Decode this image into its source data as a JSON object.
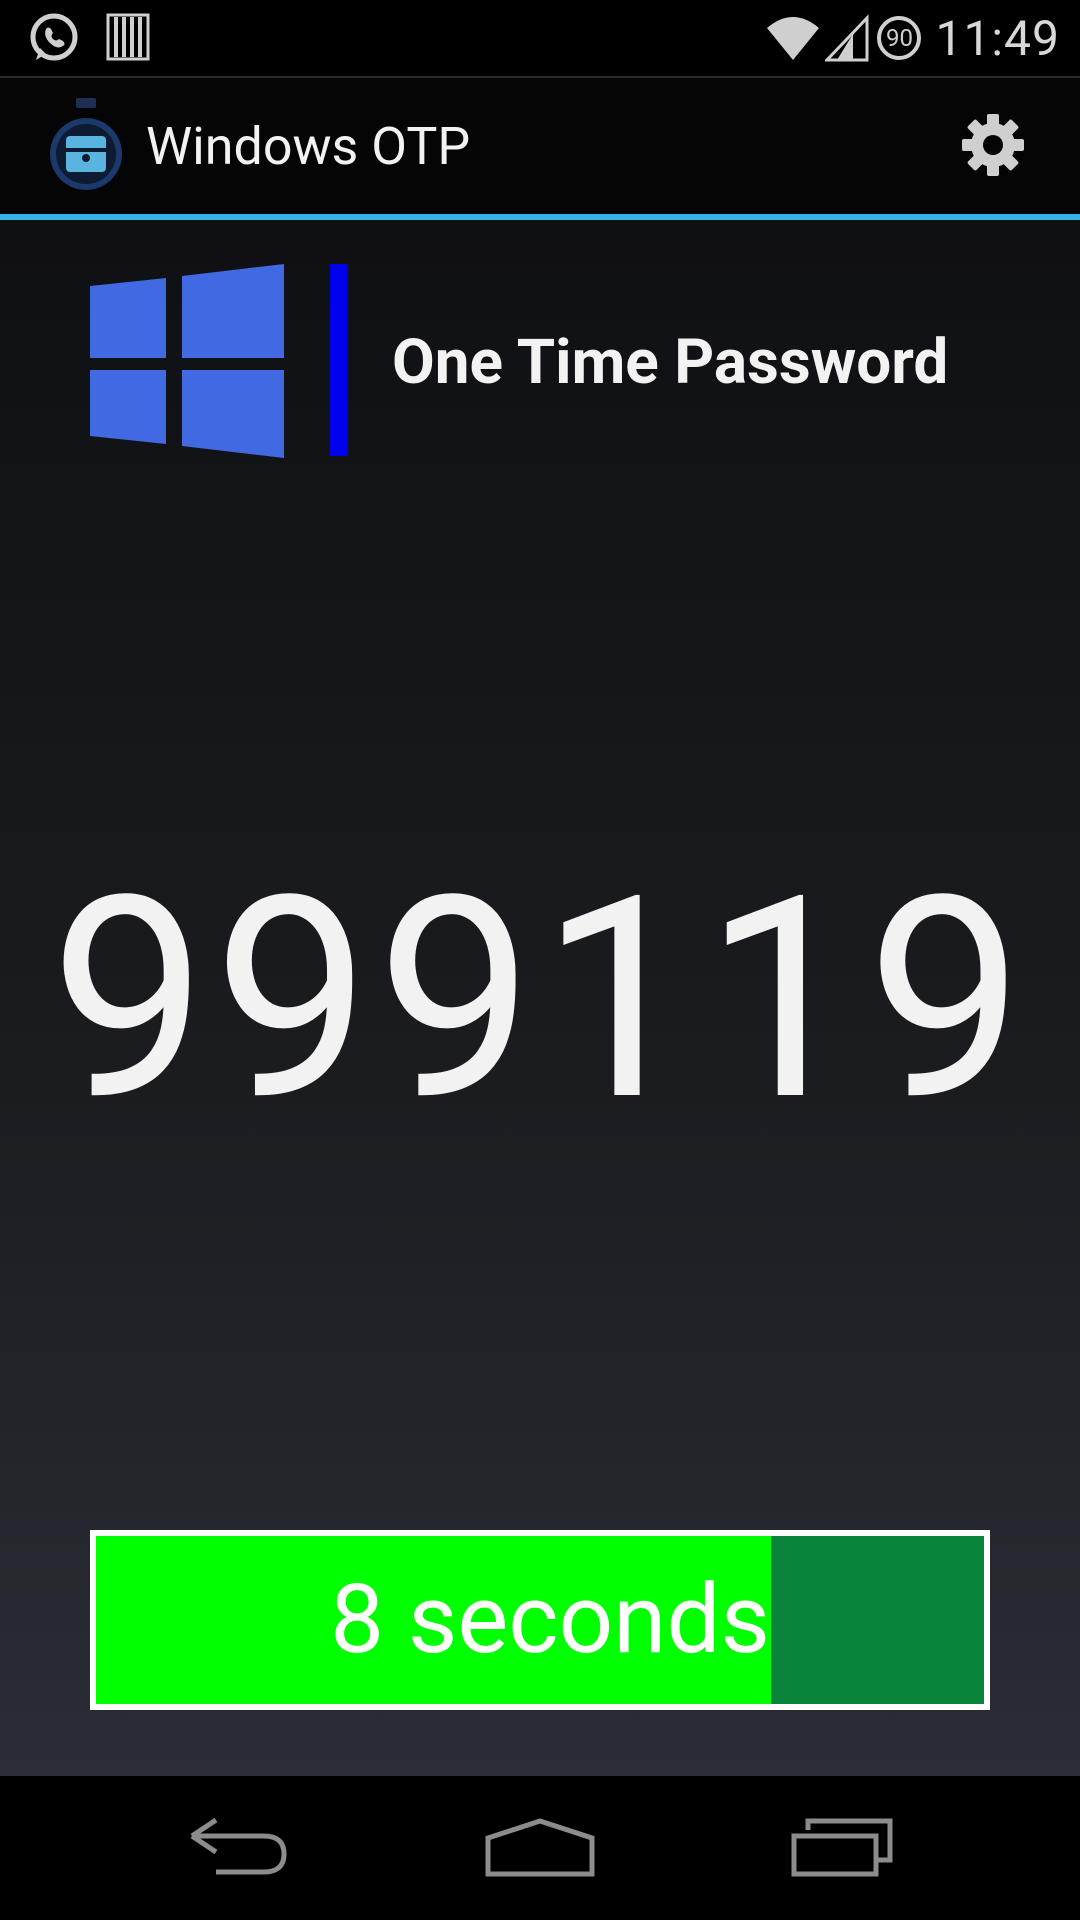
{
  "status_bar": {
    "time": "11:49",
    "battery_level": "90",
    "left_icons": [
      "whatsapp-icon",
      "barcode-icon"
    ],
    "right_icons": [
      "wifi-icon",
      "signal-icon",
      "battery-icon"
    ]
  },
  "action_bar": {
    "title": "Windows OTP",
    "settings_icon": "gear-icon"
  },
  "main": {
    "heading": "One Time Password",
    "otp_code": "999119",
    "timer": {
      "label": "8 seconds",
      "progress_fraction": 0.76
    }
  },
  "nav_bar": {
    "buttons": [
      "back-icon",
      "home-icon",
      "recents-icon"
    ]
  },
  "colors": {
    "accent": "#33b5e5",
    "divider": "#0000ee",
    "windows_blue": "#4169e1",
    "timer_fill": "#00ff00",
    "timer_track": "#08843b"
  }
}
